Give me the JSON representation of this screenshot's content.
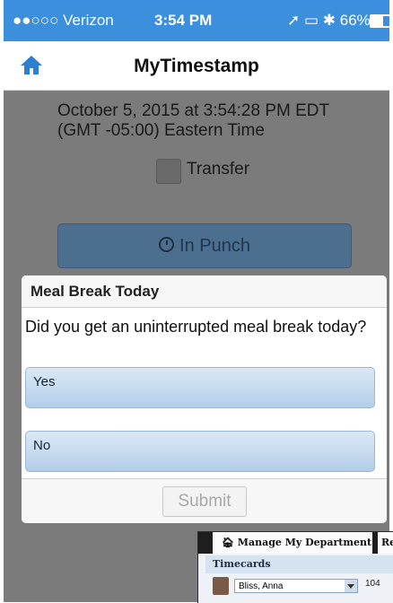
{
  "status_bar": {
    "carrier": "●●○○○ Verizon",
    "time": "3:54 PM",
    "battery": "66%"
  },
  "nav": {
    "title": "MyTimestamp",
    "home_icon": "home-icon"
  },
  "timestamp": {
    "line1": "October 5, 2015 at 3:54:28 PM EDT",
    "line2": "(GMT -05:00) Eastern Time"
  },
  "transfer": {
    "label": "Transfer",
    "checked": false
  },
  "punch_button": {
    "label": "In Punch",
    "icon": "clock-icon"
  },
  "dialog": {
    "title": "Meal Break Today",
    "message": "Did you get an uninterrupted meal break today?",
    "options": [
      "Yes",
      "No"
    ],
    "submit_label": "Submit"
  },
  "inset": {
    "nav_tab": "Manage My Department",
    "nav_tab2": "Re",
    "panel_title": "Timecards",
    "employee": "Bliss, Anna",
    "count": "104"
  }
}
